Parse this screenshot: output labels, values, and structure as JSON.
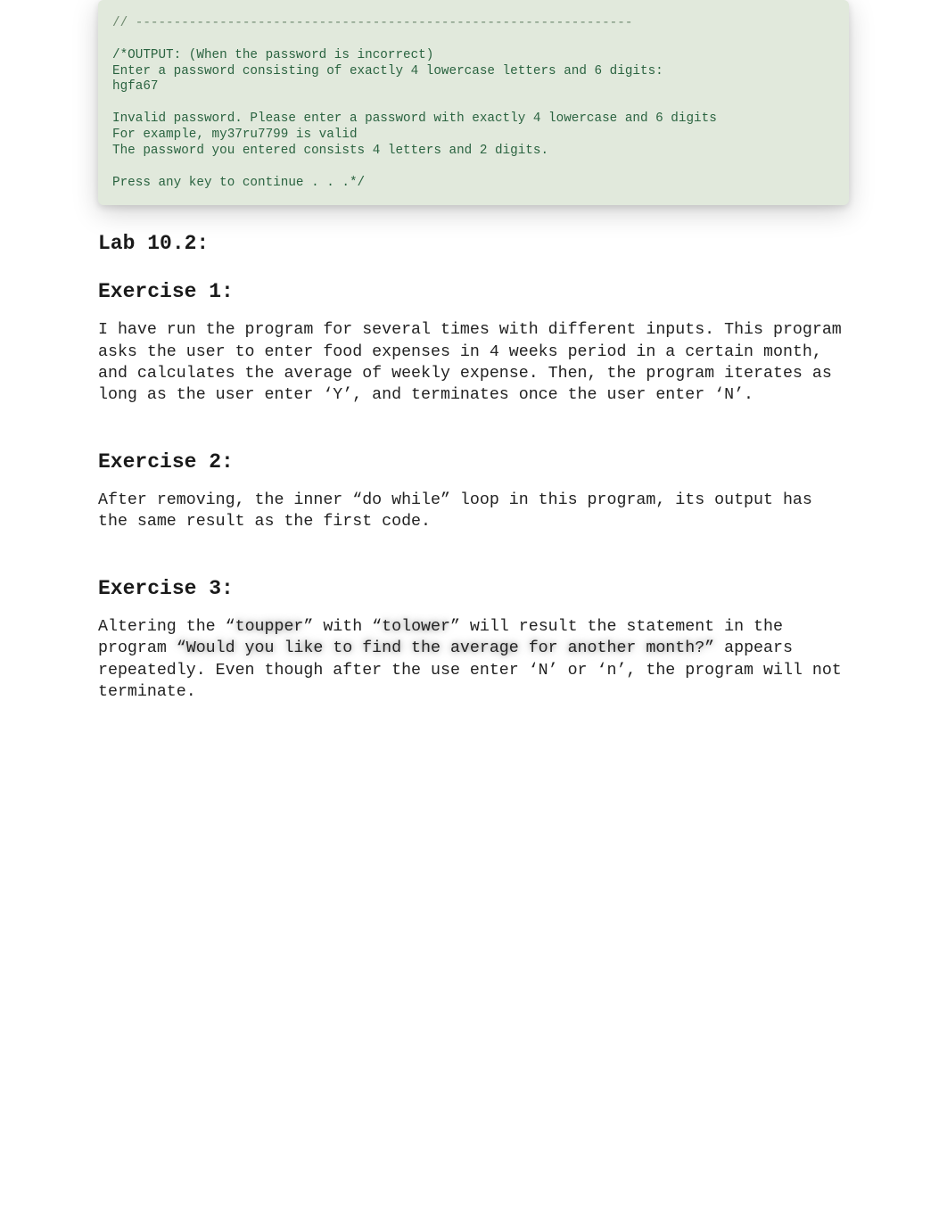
{
  "code": {
    "sep": "// -----------------------------------------------------------------",
    "l1": "/*OUTPUT: (When the password is incorrect)",
    "l2": "Enter a password consisting of exactly 4 lowercase letters and 6 digits:",
    "l3": "hgfa67",
    "l4": "Invalid password. Please enter a password with exactly 4 lowercase and 6 digits",
    "l5": "For example, my37ru7799 is valid",
    "l6": "The password you entered consists 4 letters and 2 digits.",
    "l7": "Press any key to continue . . .*/"
  },
  "lab": "Lab 10.2:",
  "ex1": {
    "title": "Exercise 1:",
    "text": "I have run the program for several times with different inputs. This program asks the user to enter food expenses in 4 weeks period in a certain month, and calculates the average of weekly expense. Then, the program iterates as long as the user enter ‘Y’, and terminates once the user enter ‘N’."
  },
  "ex2": {
    "title": "Exercise 2:",
    "text": "After removing, the inner “do while” loop in this program, its output has the same result as the first code."
  },
  "ex3": {
    "title": "Exercise 3:",
    "pre": "Altering the “",
    "hl1": "toupper",
    "mid1": "” with “",
    "hl2": "tolower",
    "mid2": "” will result the statement in the program ",
    "hl3": "“Would you like to find the average for another month?”",
    "post": " appears repeatedly. Even though after the use enter ‘N’ or ‘n’, the program will not terminate."
  }
}
